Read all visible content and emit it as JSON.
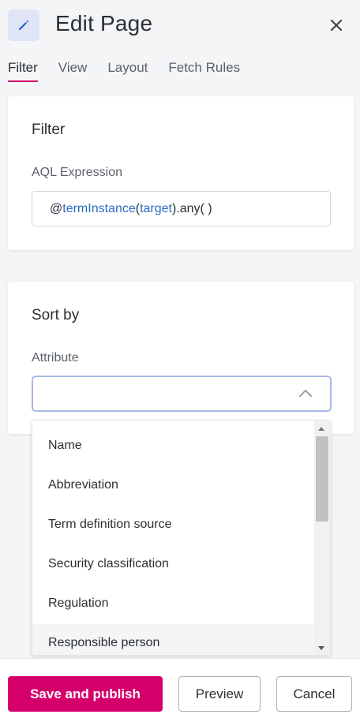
{
  "header": {
    "title": "Edit Page",
    "edit_icon": "pencil-icon",
    "close_icon": "close-icon"
  },
  "tabs": [
    {
      "label": "Filter",
      "active": true
    },
    {
      "label": "View",
      "active": false
    },
    {
      "label": "Layout",
      "active": false
    },
    {
      "label": "Fetch Rules",
      "active": false
    }
  ],
  "filter": {
    "title": "Filter",
    "aql_label": "AQL Expression",
    "expr": {
      "at": "@",
      "fn": "termInstance",
      "open": "(",
      "arg": "target",
      "rest": ").any( )"
    }
  },
  "sort": {
    "title": "Sort by",
    "attribute_label": "Attribute",
    "attribute_value": "",
    "options": [
      "Name",
      "Abbreviation",
      "Term definition source",
      "Security classification",
      "Regulation",
      "Responsible person"
    ],
    "hovered_option": "Responsible person"
  },
  "footer": {
    "save_label": "Save and publish",
    "preview_label": "Preview",
    "cancel_label": "Cancel"
  },
  "colors": {
    "accent": "#d6006c",
    "link": "#2b6cc4",
    "focus_border": "#a8b9e6"
  }
}
